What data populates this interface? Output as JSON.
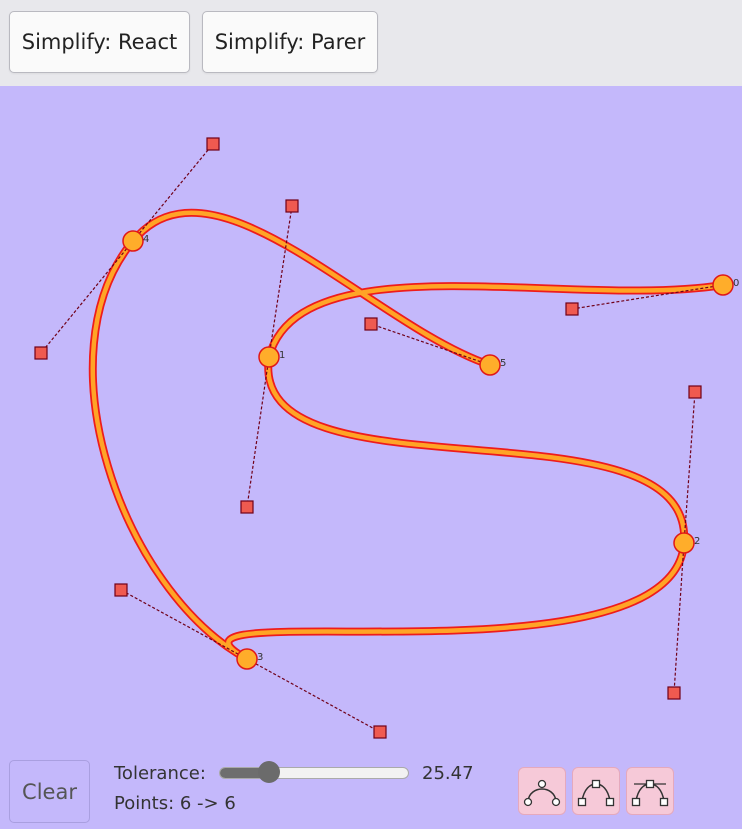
{
  "toolbar": {
    "simplify_react_label": "Simplify: React",
    "simplify_parer_label": "Simplify: Parer"
  },
  "controls": {
    "clear_label": "Clear",
    "tolerance_label": "Tolerance:",
    "tolerance_value": "25.47",
    "tolerance_fraction": 0.26,
    "points_label": "Points: 6 -> 6"
  },
  "mode_buttons": [
    {
      "name": "smooth-node-icon"
    },
    {
      "name": "corner-node-icon"
    },
    {
      "name": "symmetric-node-icon"
    }
  ],
  "colors": {
    "canvas_background": "#c4b8fb",
    "curve_outer": "#ee1c1c",
    "curve_inner": "#ffa426",
    "handle_line": "#700018",
    "handle_fill": "#ef5a50"
  },
  "nodes": [
    {
      "label": "0"
    },
    {
      "label": "1"
    },
    {
      "label": "2"
    },
    {
      "label": "3"
    },
    {
      "label": "4"
    },
    {
      "label": "5"
    }
  ]
}
